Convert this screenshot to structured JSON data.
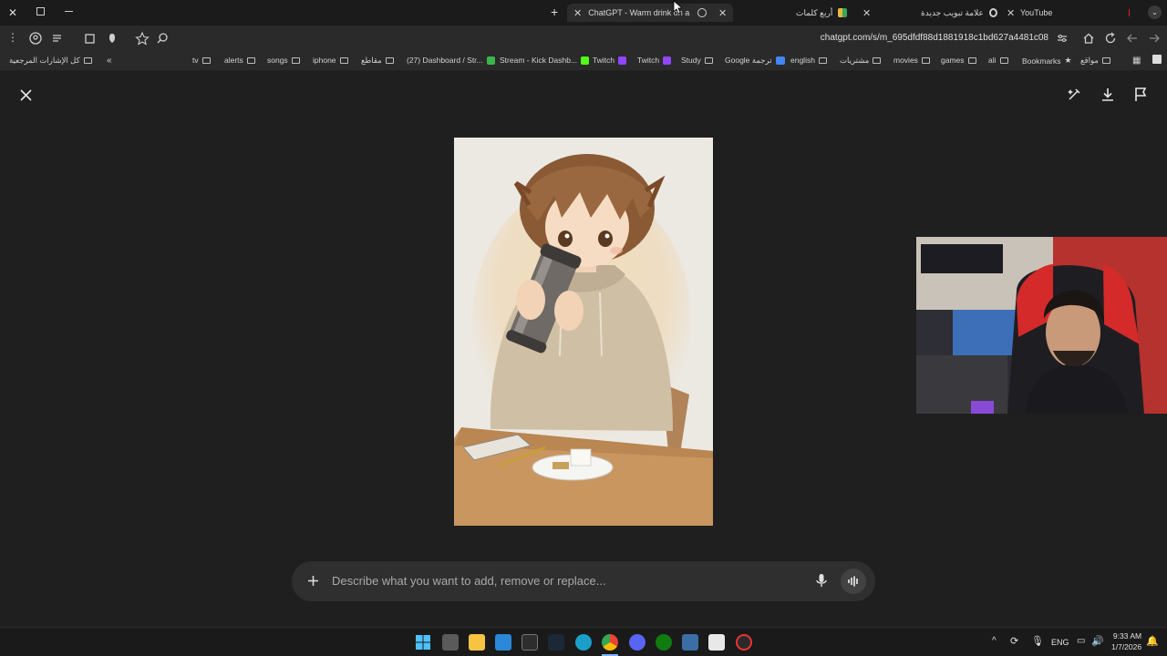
{
  "tabs": [
    {
      "title": "ChatGPT - Warm drink on a co",
      "active": true
    },
    {
      "title": "أربع كلمات",
      "active": false
    },
    {
      "title": "علامة تبويب جديدة",
      "active": false
    },
    {
      "title": "YouTube",
      "active": false
    }
  ],
  "address_bar": {
    "url": "chatgpt.com/s/m_695dfdf88d1881918c1bd627a4481c08"
  },
  "bookmarks": [
    {
      "label": "Bookmarks",
      "type": "star"
    },
    {
      "label": "مواقع",
      "type": "folder"
    },
    {
      "label": "ali",
      "type": "folder"
    },
    {
      "label": "games",
      "type": "folder"
    },
    {
      "label": "movies",
      "type": "folder"
    },
    {
      "label": "مشتريات",
      "type": "folder"
    },
    {
      "label": "english",
      "type": "folder"
    },
    {
      "label": "Google ترجمة",
      "type": "google"
    },
    {
      "label": "Study",
      "type": "folder"
    },
    {
      "label": "Twitch",
      "type": "twitch"
    },
    {
      "label": "Twitch",
      "type": "twitch"
    },
    {
      "label": "Stream - Kick Dashb...",
      "type": "kick"
    },
    {
      "label": "(27) Dashboard / Str...",
      "type": "folder"
    },
    {
      "label": "مقاطع",
      "type": "folder"
    },
    {
      "label": "iphone",
      "type": "folder"
    },
    {
      "label": "songs",
      "type": "folder"
    },
    {
      "label": "alerts",
      "type": "folder"
    },
    {
      "label": "tv",
      "type": "folder"
    },
    {
      "label": "كل الإشارات المرجعية",
      "type": "folder"
    }
  ],
  "viewer": {
    "close_icon": "close-icon",
    "edit_icon": "edit-brush-icon",
    "download_icon": "download-icon",
    "report_icon": "flag-icon"
  },
  "prompt": {
    "placeholder": "Describe what you want to add, remove or replace..."
  },
  "taskbar": {
    "language": "ENG",
    "time": "9:33 AM",
    "date": "1/7/2026"
  },
  "colors": {
    "background": "#1f1f1f",
    "prompt_bg": "#2f2f2f",
    "taskbar_bg": "#1a1a1a"
  }
}
